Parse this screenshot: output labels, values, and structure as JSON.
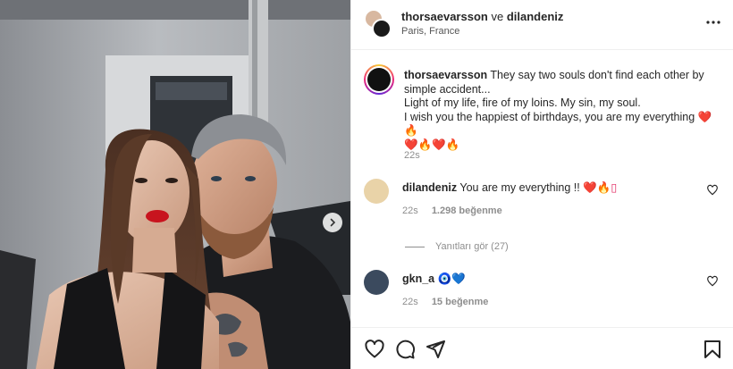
{
  "header": {
    "user1": "thorsaevarsson",
    "conjunction": "ve",
    "user2": "dilandeniz",
    "location": "Paris, France"
  },
  "caption": {
    "username": "thorsaevarsson",
    "line1": "They say two souls don't find each other by simple accident...",
    "line2": "Light of my life, fire of my loins. My sin, my soul.",
    "line3": "I wish you the happiest of birthdays, you are my everything",
    "line3_emoji": "❤️🔥",
    "line4_emoji": "❤️🔥❤️🔥",
    "time": "22s"
  },
  "comments": [
    {
      "username": "dilandeniz",
      "text": "You are my everything !!",
      "emoji": "❤️🔥▯",
      "time": "22s",
      "likes": "1.298 beğenme",
      "avatar_color": "#e9d3a8"
    },
    {
      "username": "gkn_a",
      "text": "",
      "emoji": "🧿💙",
      "time": "22s",
      "likes": "15 beğenme",
      "avatar_color": "#3b4a5e"
    }
  ],
  "replies_label": "Yanıtları gör (27)",
  "icons": {
    "more": "more-horizontal-icon",
    "next": "chevron-right-icon",
    "like": "heart-icon",
    "comment": "comment-bubble-icon",
    "share": "paper-plane-icon",
    "save": "bookmark-icon"
  },
  "colors": {
    "text": "#262626",
    "muted": "#8e8e8e",
    "divider": "#efefef",
    "accent": "#e0245e"
  }
}
